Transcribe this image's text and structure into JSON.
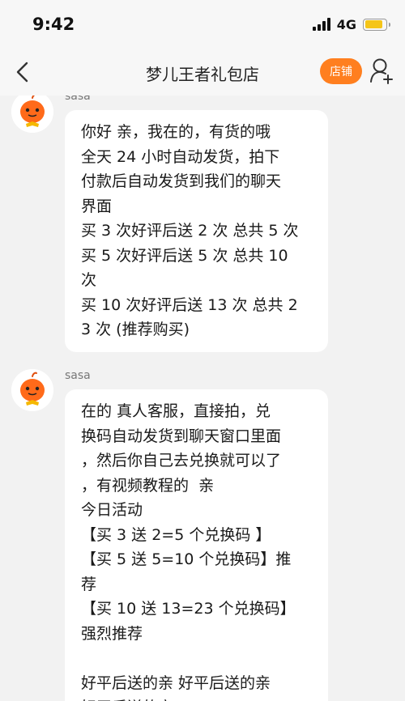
{
  "status_bar": {
    "time": "9:42",
    "network": "4G",
    "battery_level": 0.85
  },
  "header": {
    "title": "梦儿王者礼包店",
    "shop_label": "店铺"
  },
  "messages": [
    {
      "sender": "sasa",
      "lines": [
        "你好 亲，我在的，有货的哦",
        "全天 24 小时自动发货，拍下",
        "付款后自动发货到我们的聊天",
        "界面",
        "买 3 次好评后送 2 次 总共 5 次",
        "买 5 次好评后送 5 次 总共 10",
        "次",
        "买 10 次好评后送 13 次 总共 2",
        "3 次 (推荐购买)"
      ]
    },
    {
      "sender": "sasa",
      "lines": [
        "在的 真人客服，直接拍，兑",
        "换码自动发货到聊天窗口里面",
        "，然后你自己去兑换就可以了",
        "，有视频教程的  亲",
        "今日活动",
        "【买 3 送 2=5 个兑换码 】",
        "【买 5 送 5=10 个兑换码】推",
        "荐",
        "【买 10 送 13=23 个兑换码】",
        "强烈推荐",
        "",
        "好平后送的亲 好平后送的亲",
        "好平后送的亲"
      ]
    }
  ],
  "colors": {
    "accent": "#ff7f1f",
    "background": "#f2f2f2",
    "bubble": "#ffffff",
    "battery": "#f5c518"
  },
  "icons": [
    "back-icon",
    "user-icon",
    "avatar-icon"
  ]
}
